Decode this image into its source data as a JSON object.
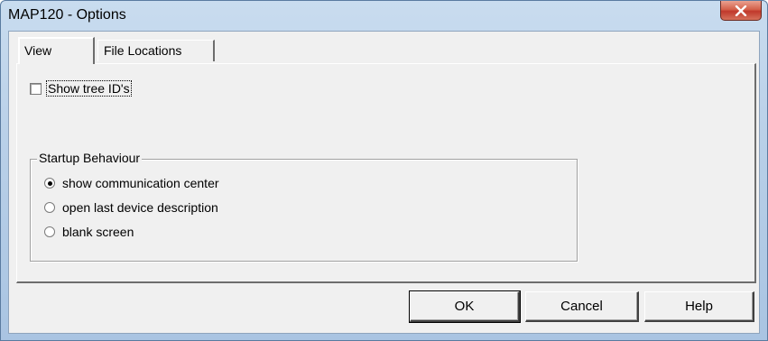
{
  "window": {
    "title": "MAP120 - Options",
    "close_icon": "close-x-icon"
  },
  "tabs": [
    {
      "label": "View",
      "selected": true
    },
    {
      "label": "File Locations",
      "selected": false
    }
  ],
  "view": {
    "show_tree_ids": {
      "label": "Show tree ID's",
      "checked": false
    },
    "startup_behaviour": {
      "legend": "Startup Behaviour",
      "options": [
        {
          "label": "show communication center",
          "selected": true
        },
        {
          "label": "open last device description",
          "selected": false
        },
        {
          "label": "blank screen",
          "selected": false
        }
      ]
    }
  },
  "buttons": {
    "ok": "OK",
    "cancel": "Cancel",
    "help": "Help"
  },
  "colors": {
    "title_gradient": "#b9d0e8",
    "close_button": "#c0392b",
    "dialog_background": "#f0f0f0"
  }
}
